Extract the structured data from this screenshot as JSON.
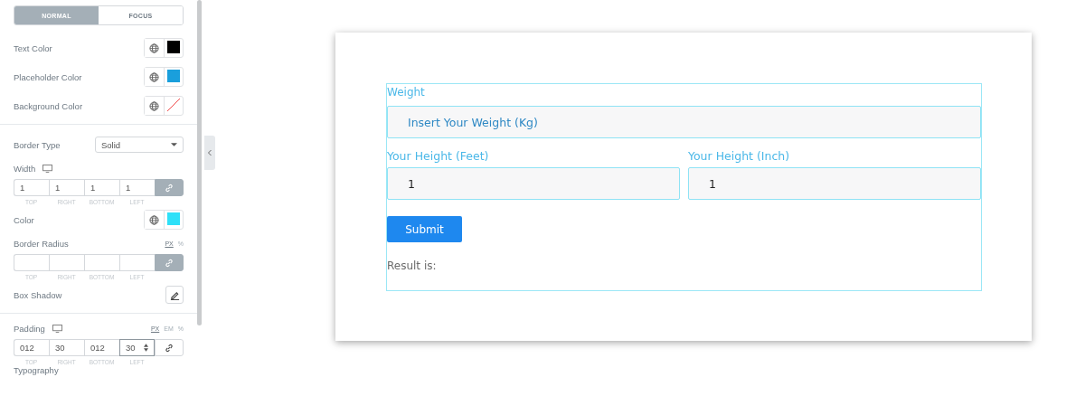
{
  "panel": {
    "tabs": [
      {
        "label": "NORMAL",
        "selected": true
      },
      {
        "label": "FOCUS",
        "selected": false
      }
    ],
    "colors": [
      {
        "label": "Text Color",
        "kind": "swatch",
        "color": "#000000"
      },
      {
        "label": "Placeholder Color",
        "kind": "swatch",
        "color": "#1a9fdc"
      },
      {
        "label": "Background Color",
        "kind": "none"
      }
    ],
    "border_type": {
      "label": "Border Type",
      "value": "Solid"
    },
    "width": {
      "label": "Width",
      "linked": true,
      "sides": [
        {
          "value": "1",
          "caption": "TOP"
        },
        {
          "value": "1",
          "caption": "RIGHT"
        },
        {
          "value": "1",
          "caption": "BOTTOM"
        },
        {
          "value": "1",
          "caption": "LEFT"
        }
      ]
    },
    "border_color": {
      "label": "Color",
      "color": "#2ee0f8"
    },
    "border_radius": {
      "label": "Border Radius",
      "units": [
        {
          "label": "PX",
          "selected": true
        },
        {
          "label": "%",
          "selected": false
        }
      ],
      "linked": true,
      "sides": [
        {
          "caption": "TOP"
        },
        {
          "caption": "RIGHT"
        },
        {
          "caption": "BOTTOM"
        },
        {
          "caption": "LEFT"
        }
      ]
    },
    "box_shadow": {
      "label": "Box Shadow"
    },
    "padding": {
      "label": "Padding",
      "units": [
        {
          "label": "PX",
          "selected": true
        },
        {
          "label": "EM",
          "selected": false
        },
        {
          "label": "%",
          "selected": false
        }
      ],
      "linked": false,
      "sides": [
        {
          "value": "012",
          "caption": "TOP",
          "focused": false
        },
        {
          "value": "30",
          "caption": "RIGHT",
          "focused": false
        },
        {
          "value": "012",
          "caption": "BOTTOM",
          "focused": false
        },
        {
          "value": "30",
          "caption": "LEFT",
          "focused": true
        }
      ]
    },
    "typography": {
      "label": "Typography"
    }
  },
  "form": {
    "weight": {
      "label": "Weight",
      "placeholder": "Insert Your Weight (Kg)"
    },
    "fields": [
      {
        "label": "Your Height (Feet)",
        "value": "1"
      },
      {
        "label": "Your Height (Inch)",
        "value": "1"
      }
    ],
    "submit": "Submit",
    "result": "Result is:"
  }
}
